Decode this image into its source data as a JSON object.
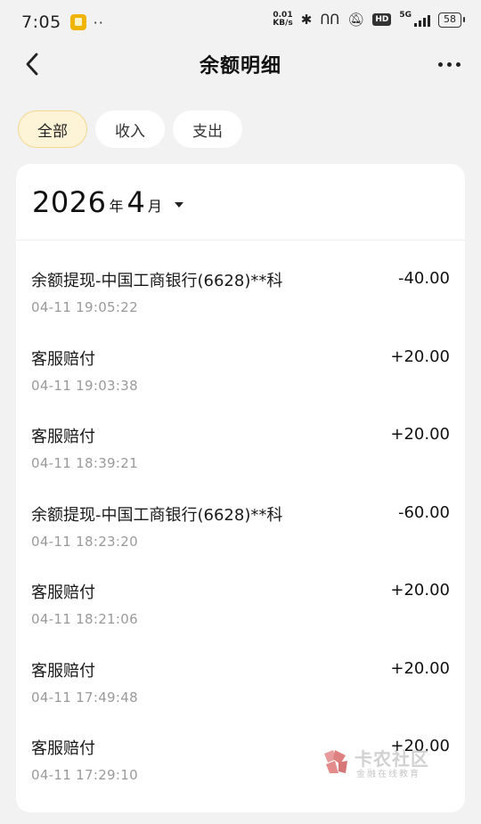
{
  "status_bar": {
    "time": "7:05",
    "dots": "··",
    "net_speed_value": "0.01",
    "net_speed_unit": "KB/s",
    "hd": "HD",
    "net_type": "5G",
    "battery": "58"
  },
  "header": {
    "title": "余额明细"
  },
  "tabs": [
    {
      "label": "全部",
      "active": true
    },
    {
      "label": "收入",
      "active": false
    },
    {
      "label": "支出",
      "active": false
    }
  ],
  "filter": {
    "year": "2026",
    "year_unit": "年",
    "month": "4",
    "month_unit": "月"
  },
  "transactions": [
    {
      "title": "余额提现-中国工商银行(6628)**科",
      "time": "04-11 19:05:22",
      "amount": "-40.00"
    },
    {
      "title": "客服赔付",
      "time": "04-11 19:03:38",
      "amount": "+20.00"
    },
    {
      "title": "客服赔付",
      "time": "04-11 18:39:21",
      "amount": "+20.00"
    },
    {
      "title": "余额提现-中国工商银行(6628)**科",
      "time": "04-11 18:23:20",
      "amount": "-60.00"
    },
    {
      "title": "客服赔付",
      "time": "04-11 18:21:06",
      "amount": "+20.00"
    },
    {
      "title": "客服赔付",
      "time": "04-11 17:49:48",
      "amount": "+20.00"
    },
    {
      "title": "客服赔付",
      "time": "04-11 17:29:10",
      "amount": "+20.00"
    }
  ],
  "watermark": {
    "name": "卡农社区",
    "slogan": "金融在线教育"
  },
  "colors": {
    "background": "#f2f2f2",
    "active_tab_bg": "#fdf4d8",
    "active_tab_border": "#f3d890",
    "secondary_text": "#9a9a9a"
  }
}
